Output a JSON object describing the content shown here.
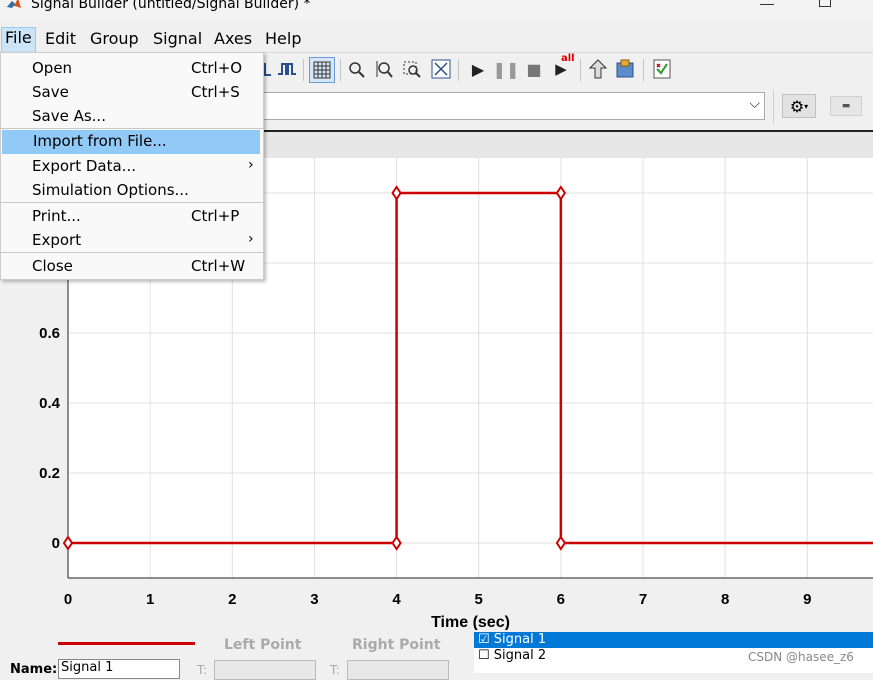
{
  "window": {
    "title": "Signal Builder (untitled/Signal Builder) *"
  },
  "menubar": [
    "File",
    "Edit",
    "Group",
    "Signal",
    "Axes",
    "Help"
  ],
  "file_menu": {
    "items": [
      {
        "label": "Open",
        "shortcut": "Ctrl+O"
      },
      {
        "label": "Save",
        "shortcut": "Ctrl+S"
      },
      {
        "label": "Save As...",
        "shortcut": ""
      },
      {
        "label": "Import from File...",
        "shortcut": "",
        "highlighted": true
      },
      {
        "label": "Export Data...",
        "shortcut": "",
        "submenu": true
      },
      {
        "label": "Simulation Options...",
        "shortcut": ""
      },
      {
        "label": "Print...",
        "shortcut": "Ctrl+P"
      },
      {
        "label": "Export",
        "shortcut": "",
        "submenu": true
      },
      {
        "label": "Close",
        "shortcut": "Ctrl+W"
      }
    ]
  },
  "toolbar": {
    "icons": [
      "step-signal-icon",
      "grid-icon",
      "zoom-x-icon",
      "zoom-y-icon",
      "zoom-xy-icon",
      "fit-icon",
      "play-icon",
      "pause-icon",
      "stop-icon",
      "run-all-icon",
      "move-up-icon",
      "open-model-icon",
      "check-icon"
    ],
    "run_all_badge": "all"
  },
  "chart_data": {
    "type": "line",
    "xlabel": "Time (sec)",
    "ylabel": "",
    "xlim": [
      0,
      9.8
    ],
    "ylim": [
      -0.1,
      1.1
    ],
    "x_ticks": [
      0,
      1,
      2,
      3,
      4,
      5,
      6,
      7,
      8,
      9
    ],
    "y_ticks": [
      0,
      0.2,
      0.4,
      0.6
    ],
    "y_tick_labels": [
      "0",
      "0.2",
      "0.4",
      "0.6"
    ],
    "grid": true,
    "series": [
      {
        "name": "Signal 1",
        "color": "#cc0000",
        "x": [
          0,
          4,
          4,
          6,
          6,
          9.8
        ],
        "y": [
          0,
          0,
          1,
          1,
          0,
          0
        ],
        "markers": [
          [
            0,
            0
          ],
          [
            4,
            0
          ],
          [
            4,
            1
          ],
          [
            6,
            1
          ],
          [
            6,
            0
          ]
        ]
      }
    ]
  },
  "bottom": {
    "left_point_label": "Left Point",
    "right_point_label": "Right Point",
    "name_label": "Name:",
    "name_value": "Signal 1",
    "t_label": "T:"
  },
  "signals": [
    {
      "label": "☑ Signal 1",
      "selected": true
    },
    {
      "label": "☐ Signal 2",
      "selected": false
    }
  ],
  "watermark": "CSDN @hasee_z6",
  "colors": {
    "accent": "#0078d7",
    "signal": "#cc0000",
    "menu_highlight": "#91c9f7"
  }
}
